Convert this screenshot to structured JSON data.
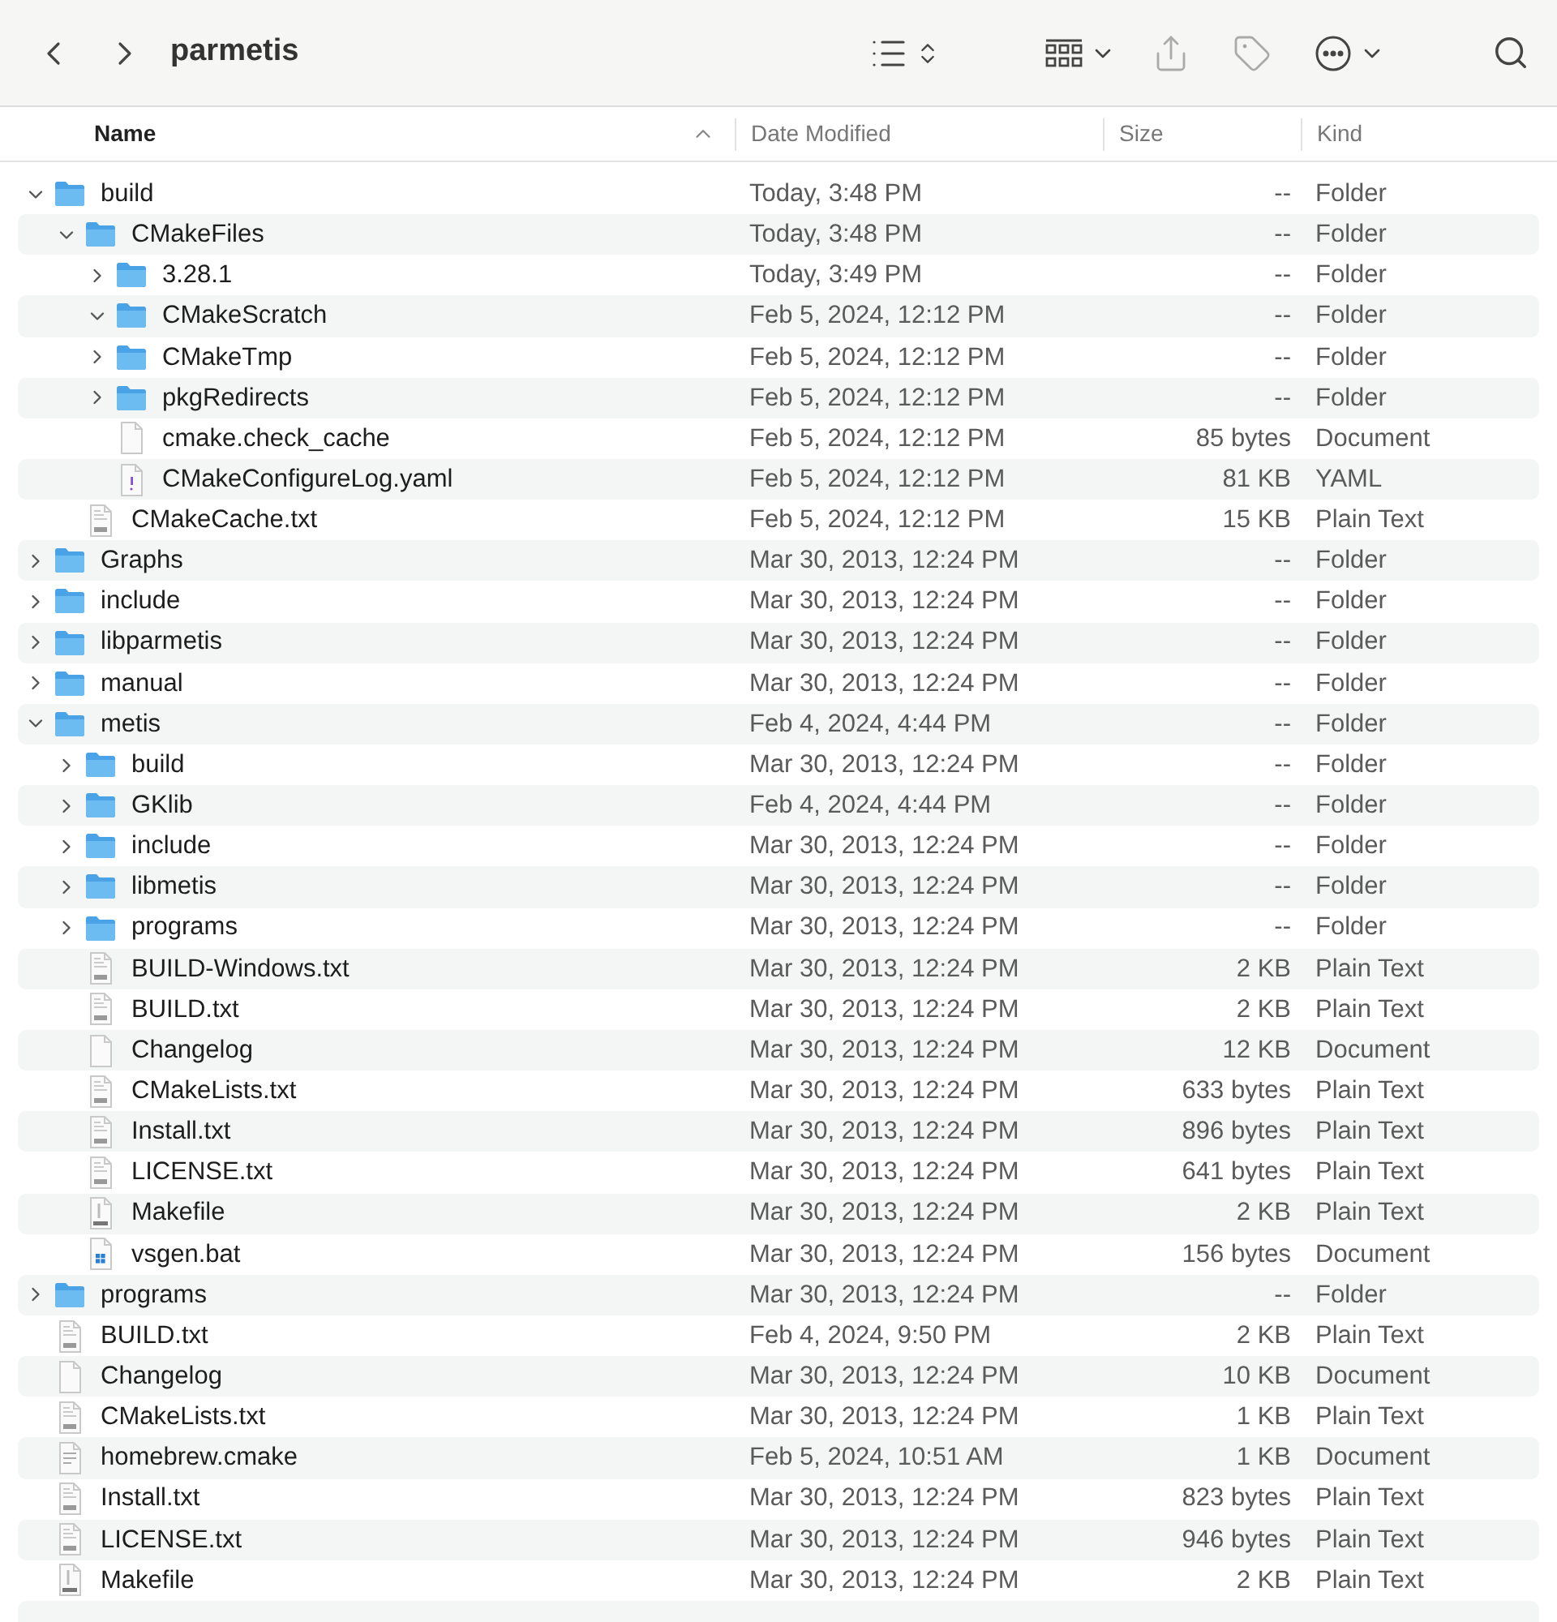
{
  "window": {
    "title": "parmetis"
  },
  "columns": [
    {
      "label": "Name",
      "sorted": true
    },
    {
      "label": "Date Modified",
      "sorted": false
    },
    {
      "label": "Size",
      "sorted": false
    },
    {
      "label": "Kind",
      "sorted": false
    }
  ],
  "files": [
    {
      "name": "build",
      "kind": "folder",
      "expanded": true,
      "date": "Today, 3:48 PM",
      "size": "--",
      "file_kind": "Folder",
      "children": [
        {
          "name": "CMakeFiles",
          "kind": "folder",
          "expanded": true,
          "date": "Today, 3:48 PM",
          "size": "--",
          "file_kind": "Folder",
          "children": [
            {
              "name": "3.28.1",
              "kind": "folder",
              "expanded": false,
              "date": "Today, 3:49 PM",
              "size": "--",
              "file_kind": "Folder"
            },
            {
              "name": "CMakeScratch",
              "kind": "folder",
              "expanded": true,
              "date": "Feb 5, 2024, 12:12 PM",
              "size": "--",
              "file_kind": "Folder"
            },
            {
              "name": "CMakeTmp",
              "kind": "folder",
              "expanded": false,
              "date": "Feb 5, 2024, 12:12 PM",
              "size": "--",
              "file_kind": "Folder"
            },
            {
              "name": "pkgRedirects",
              "kind": "folder",
              "expanded": false,
              "date": "Feb 5, 2024, 12:12 PM",
              "size": "--",
              "file_kind": "Folder"
            },
            {
              "name": "cmake.check_cache",
              "kind": "blank",
              "date": "Feb 5, 2024, 12:12 PM",
              "size": "85 bytes",
              "file_kind": "Document"
            },
            {
              "name": "CMakeConfigureLog.yaml",
              "kind": "yaml",
              "date": "Feb 5, 2024, 12:12 PM",
              "size": "81 KB",
              "file_kind": "YAML"
            }
          ]
        },
        {
          "name": "CMakeCache.txt",
          "kind": "txt",
          "date": "Feb 5, 2024, 12:12 PM",
          "size": "15 KB",
          "file_kind": "Plain Text"
        }
      ]
    },
    {
      "name": "Graphs",
      "kind": "folder",
      "expanded": false,
      "date": "Mar 30, 2013, 12:24 PM",
      "size": "--",
      "file_kind": "Folder"
    },
    {
      "name": "include",
      "kind": "folder",
      "expanded": false,
      "date": "Mar 30, 2013, 12:24 PM",
      "size": "--",
      "file_kind": "Folder"
    },
    {
      "name": "libparmetis",
      "kind": "folder",
      "expanded": false,
      "date": "Mar 30, 2013, 12:24 PM",
      "size": "--",
      "file_kind": "Folder"
    },
    {
      "name": "manual",
      "kind": "folder",
      "expanded": false,
      "date": "Mar 30, 2013, 12:24 PM",
      "size": "--",
      "file_kind": "Folder"
    },
    {
      "name": "metis",
      "kind": "folder",
      "expanded": true,
      "date": "Feb 4, 2024, 4:44 PM",
      "size": "--",
      "file_kind": "Folder",
      "children": [
        {
          "name": "build",
          "kind": "folder",
          "expanded": false,
          "date": "Mar 30, 2013, 12:24 PM",
          "size": "--",
          "file_kind": "Folder"
        },
        {
          "name": "GKlib",
          "kind": "folder",
          "expanded": false,
          "date": "Feb 4, 2024, 4:44 PM",
          "size": "--",
          "file_kind": "Folder"
        },
        {
          "name": "include",
          "kind": "folder",
          "expanded": false,
          "date": "Mar 30, 2013, 12:24 PM",
          "size": "--",
          "file_kind": "Folder"
        },
        {
          "name": "libmetis",
          "kind": "folder",
          "expanded": false,
          "date": "Mar 30, 2013, 12:24 PM",
          "size": "--",
          "file_kind": "Folder"
        },
        {
          "name": "programs",
          "kind": "folder",
          "expanded": false,
          "date": "Mar 30, 2013, 12:24 PM",
          "size": "--",
          "file_kind": "Folder"
        },
        {
          "name": "BUILD-Windows.txt",
          "kind": "txt",
          "date": "Mar 30, 2013, 12:24 PM",
          "size": "2 KB",
          "file_kind": "Plain Text"
        },
        {
          "name": "BUILD.txt",
          "kind": "txt",
          "date": "Mar 30, 2013, 12:24 PM",
          "size": "2 KB",
          "file_kind": "Plain Text"
        },
        {
          "name": "Changelog",
          "kind": "blank",
          "date": "Mar 30, 2013, 12:24 PM",
          "size": "12 KB",
          "file_kind": "Document"
        },
        {
          "name": "CMakeLists.txt",
          "kind": "txt",
          "date": "Mar 30, 2013, 12:24 PM",
          "size": "633 bytes",
          "file_kind": "Plain Text"
        },
        {
          "name": "Install.txt",
          "kind": "txt",
          "date": "Mar 30, 2013, 12:24 PM",
          "size": "896 bytes",
          "file_kind": "Plain Text"
        },
        {
          "name": "LICENSE.txt",
          "kind": "txt",
          "date": "Mar 30, 2013, 12:24 PM",
          "size": "641 bytes",
          "file_kind": "Plain Text"
        },
        {
          "name": "Makefile",
          "kind": "makefile",
          "date": "Mar 30, 2013, 12:24 PM",
          "size": "2 KB",
          "file_kind": "Plain Text"
        },
        {
          "name": "vsgen.bat",
          "kind": "bat",
          "date": "Mar 30, 2013, 12:24 PM",
          "size": "156 bytes",
          "file_kind": "Document"
        }
      ]
    },
    {
      "name": "programs",
      "kind": "folder",
      "expanded": false,
      "date": "Mar 30, 2013, 12:24 PM",
      "size": "--",
      "file_kind": "Folder"
    },
    {
      "name": "BUILD.txt",
      "kind": "txt",
      "date": "Feb 4, 2024, 9:50 PM",
      "size": "2 KB",
      "file_kind": "Plain Text"
    },
    {
      "name": "Changelog",
      "kind": "blank",
      "date": "Mar 30, 2013, 12:24 PM",
      "size": "10 KB",
      "file_kind": "Document"
    },
    {
      "name": "CMakeLists.txt",
      "kind": "txt",
      "date": "Mar 30, 2013, 12:24 PM",
      "size": "1 KB",
      "file_kind": "Plain Text"
    },
    {
      "name": "homebrew.cmake",
      "kind": "lines",
      "date": "Feb 5, 2024, 10:51 AM",
      "size": "1 KB",
      "file_kind": "Document"
    },
    {
      "name": "Install.txt",
      "kind": "txt",
      "date": "Mar 30, 2013, 12:24 PM",
      "size": "823 bytes",
      "file_kind": "Plain Text"
    },
    {
      "name": "LICENSE.txt",
      "kind": "txt",
      "date": "Mar 30, 2013, 12:24 PM",
      "size": "946 bytes",
      "file_kind": "Plain Text"
    },
    {
      "name": "Makefile",
      "kind": "makefile",
      "date": "Mar 30, 2013, 12:24 PM",
      "size": "2 KB",
      "file_kind": "Plain Text"
    }
  ]
}
